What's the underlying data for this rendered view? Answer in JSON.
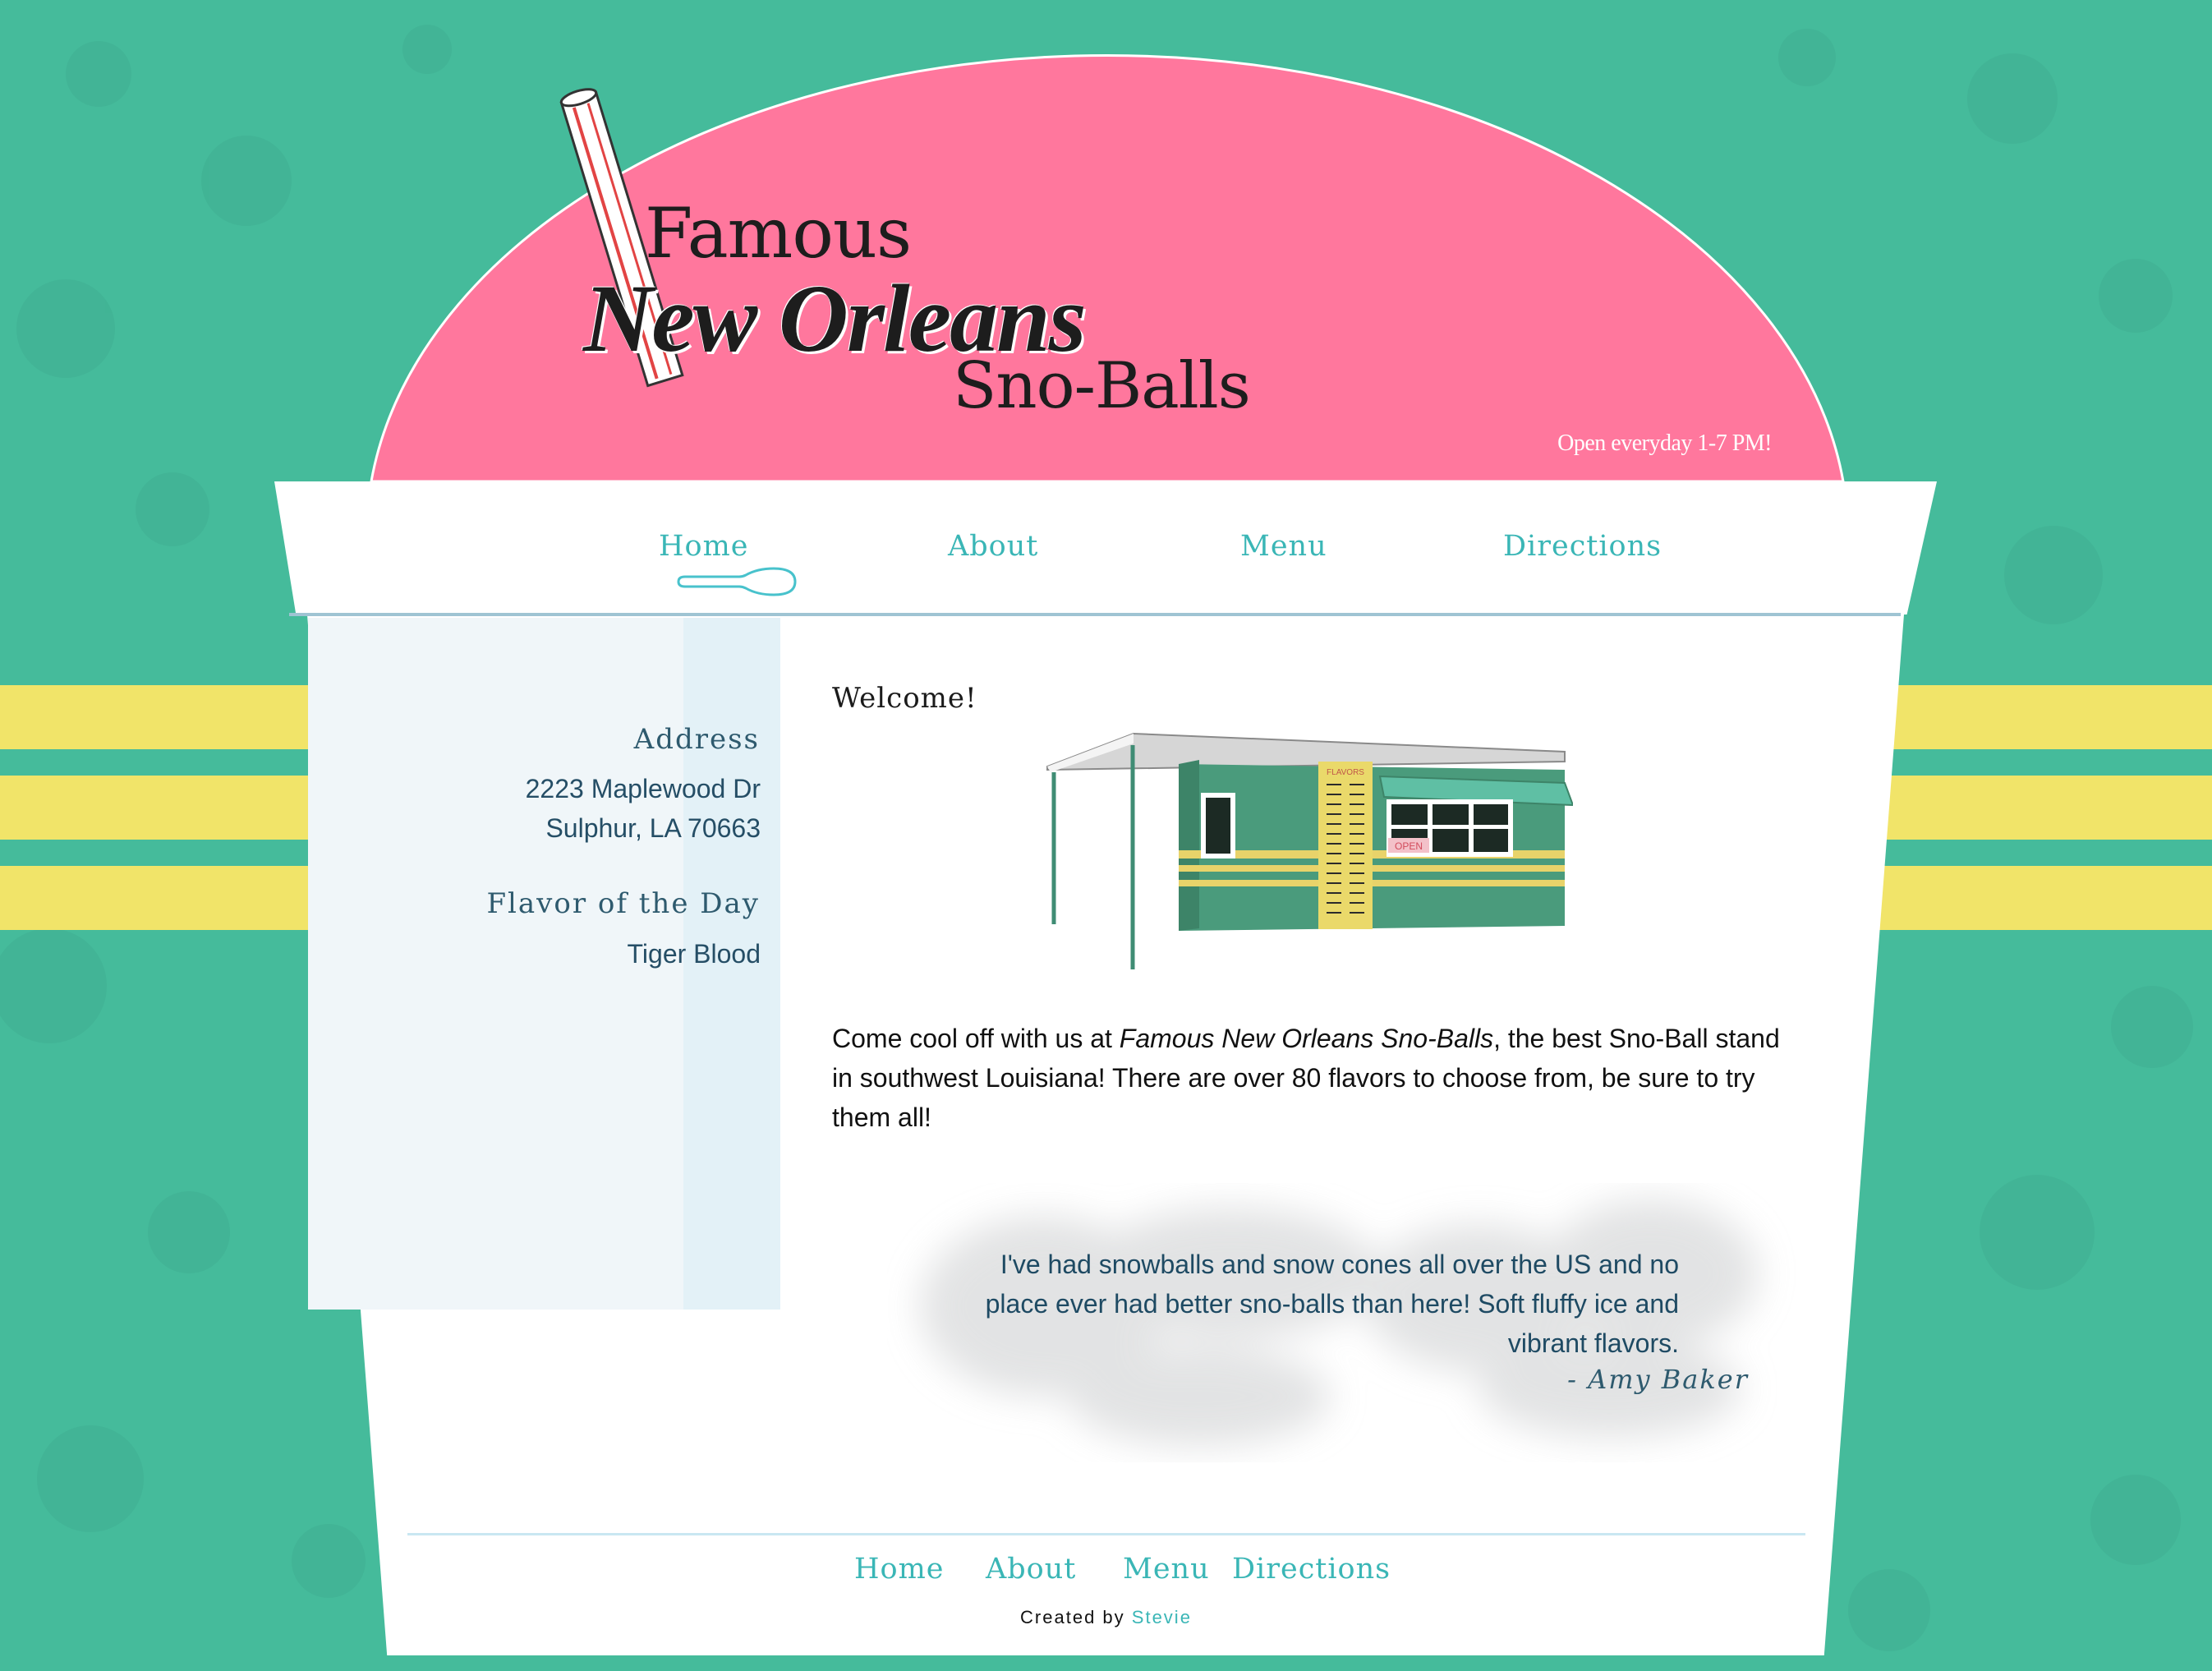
{
  "brand": {
    "line1": "Famous",
    "line2": "New Orleans",
    "line3": "Sno-Balls",
    "hours": "Open everyday 1-7 PM!"
  },
  "colors": {
    "background": "#45bb9b",
    "dome_pink": "#ff779d",
    "stripe_yellow": "#f1e469",
    "link_teal": "#3ab6b6",
    "text_navy": "#254e66"
  },
  "nav": {
    "items": [
      {
        "label": "Home",
        "active": true
      },
      {
        "label": "About"
      },
      {
        "label": "Menu"
      },
      {
        "label": "Directions"
      }
    ],
    "active_indicator_icon": "spoon-icon"
  },
  "sidebar": {
    "address_heading": "Address",
    "address_line1": "2223 Maplewood Dr",
    "address_line2": "Sulphur, LA 70663",
    "flavor_heading": "Flavor of the Day",
    "flavor_value": "Tiger Blood"
  },
  "main": {
    "welcome": "Welcome!",
    "shack_signs": {
      "flavors": "FLAVORS",
      "open": "OPEN"
    },
    "intro_before": "Come cool off with us at ",
    "intro_emphasis": "Famous New Orleans Sno-Balls",
    "intro_after": ", the best Sno-Ball stand in southwest Louisiana! There are over 80 flavors to choose from, be sure to try them all!",
    "testimonial": "I've had snowballs and snow cones all over the US and no place ever had better sno-balls than here! Soft fluffy ice and vibrant flavors.",
    "testimonial_author": "- Amy Baker"
  },
  "footer": {
    "links": [
      "Home",
      "About",
      "Menu",
      "Directions"
    ],
    "credit_prefix": "Created by ",
    "credit_author": "Stevie"
  }
}
